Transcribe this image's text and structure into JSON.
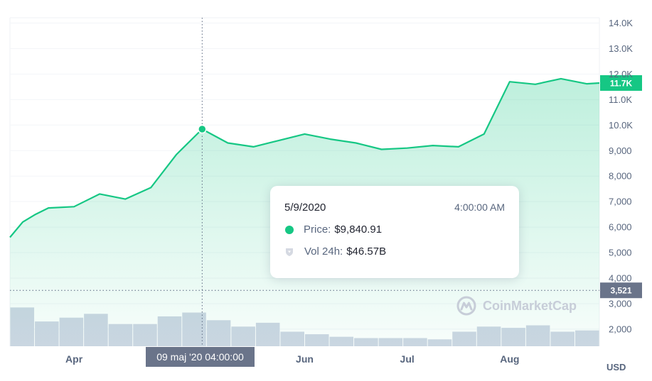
{
  "chart_data": {
    "type": "area",
    "currency_label": "USD",
    "y_ticks": [
      "2,000",
      "3,000",
      "4,000",
      "5,000",
      "6,000",
      "7,000",
      "8,000",
      "9,000",
      "10.0K",
      "11.0K",
      "12.0K",
      "13.0K",
      "14.0K"
    ],
    "y_tick_values": [
      2000,
      3000,
      4000,
      5000,
      6000,
      7000,
      8000,
      9000,
      10000,
      11000,
      12000,
      13000,
      14000
    ],
    "ylim": [
      1500,
      14000
    ],
    "x_ticks": [
      {
        "label": "Apr",
        "x": 2.5
      },
      {
        "label": "Jun",
        "x": 11.5
      },
      {
        "label": "Jul",
        "x": 15.5
      },
      {
        "label": "Aug",
        "x": 19.5
      }
    ],
    "xlim": [
      0,
      23
    ],
    "series": [
      {
        "x": [
          0,
          0.5,
          1,
          1.5,
          2.5,
          3.5,
          4.5,
          5.5,
          6.5,
          7.5,
          8.5,
          9.5,
          10.5,
          11.5,
          12.5,
          13.5,
          14.5,
          15.5,
          16.5,
          17.5,
          18.5,
          19.5,
          20.5,
          21.5,
          22.5,
          23
        ],
        "values": [
          5600,
          6200,
          6500,
          6750,
          6800,
          7300,
          7100,
          7550,
          8850,
          9840.91,
          9300,
          9150,
          9400,
          9650,
          9450,
          9300,
          9050,
          9100,
          9200,
          9150,
          9650,
          11700,
          11600,
          11820,
          11620,
          11650
        ]
      }
    ],
    "volume": [
      2.85,
      2.3,
      2.45,
      2.6,
      2.2,
      2.2,
      2.5,
      2.65,
      2.35,
      2.1,
      2.25,
      1.9,
      1.8,
      1.7,
      1.65,
      1.65,
      1.65,
      1.6,
      1.9,
      2.1,
      2.05,
      2.15,
      1.9,
      1.95
    ],
    "volume_color": "#cfd6e4",
    "line_color": "#16c784",
    "current_price_label": "11.7K",
    "current_price": 11650,
    "ref_line_label": "3,521",
    "ref_line_value": 3521,
    "crosshair_label": "09 maj '20   04:00:00",
    "crosshair_x": 7.5,
    "highlight_value": 9840.91
  },
  "tooltip": {
    "date": "5/9/2020",
    "time": "4:00:00 AM",
    "price_label": "Price:",
    "price_value": "$9,840.91",
    "vol_label": "Vol 24h:",
    "vol_value": "$46.57B"
  },
  "watermark": "CoinMarketCap",
  "icons": {
    "price_dot": "green-dot-icon",
    "volume": "shield-icon",
    "logo": "coinmarketcap-logo"
  }
}
